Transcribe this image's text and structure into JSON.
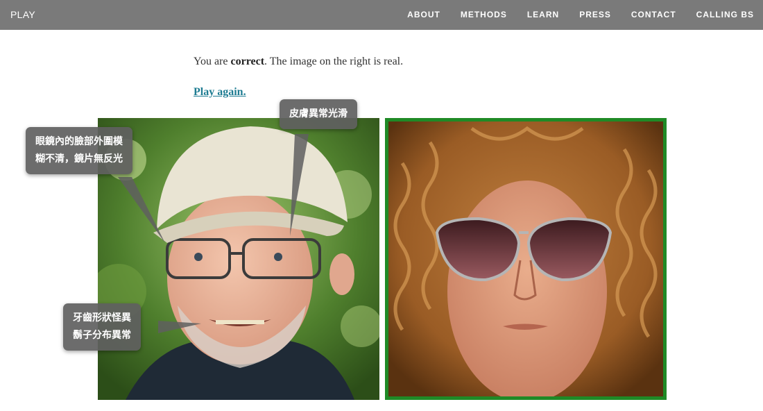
{
  "header": {
    "brand": "PLAY",
    "nav": [
      "ABOUT",
      "METHODS",
      "LEARN",
      "PRESS",
      "CONTACT",
      "CALLING BS"
    ]
  },
  "result": {
    "prefix": "You are ",
    "verdict": "correct",
    "suffix": ". The image on the right is real.",
    "play_again": "Play again."
  },
  "annotations": {
    "glasses": [
      "眼鏡內的臉部外圍模",
      "糊不清，鏡片無反光"
    ],
    "skin": "皮膚異常光滑",
    "teeth": [
      "牙齒形狀怪異",
      "鬍子分布異常"
    ]
  },
  "colors": {
    "nav_bg": "#7a7a7a",
    "link": "#1e7c92",
    "real_frame": "#1f8a26"
  }
}
